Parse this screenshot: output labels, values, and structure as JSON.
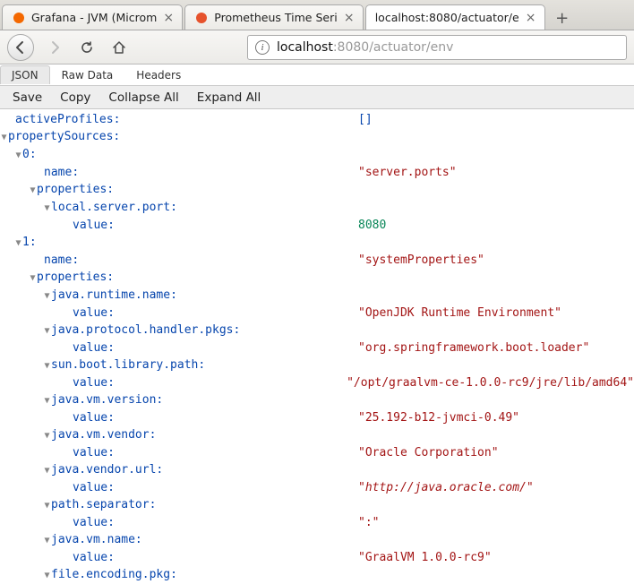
{
  "tabs": [
    {
      "title": "Grafana - JVM (Microm"
    },
    {
      "title": "Prometheus Time Seri"
    },
    {
      "title": "localhost:8080/actuator/e"
    }
  ],
  "url": {
    "host": "localhost",
    "portpath": ":8080/actuator/env"
  },
  "sub_tabs": {
    "json": "JSON",
    "raw": "Raw Data",
    "headers": "Headers"
  },
  "actions": {
    "save": "Save",
    "copy": "Copy",
    "collapse": "Collapse All",
    "expand": "Expand All"
  },
  "tree": {
    "activeProfiles_k": "activeProfiles",
    "activeProfiles_v": "[]",
    "propertySources_k": "propertySources",
    "ps0_idx": "0",
    "name_k": "name",
    "properties_k": "properties",
    "value_k": "value",
    "ps0_name_v": "\"server.ports\"",
    "ps0_prop0_k": "local.server.port",
    "ps0_prop0_v": "8080",
    "ps1_idx": "1",
    "ps1_name_v": "\"systemProperties\"",
    "ps1_p0_k": "java.runtime.name",
    "ps1_p0_v": "\"OpenJDK Runtime Environment\"",
    "ps1_p1_k": "java.protocol.handler.pkgs",
    "ps1_p1_v": "\"org.springframework.boot.loader\"",
    "ps1_p2_k": "sun.boot.library.path",
    "ps1_p2_v": "\"/opt/graalvm-ce-1.0.0-rc9/jre/lib/amd64\"",
    "ps1_p3_k": "java.vm.version",
    "ps1_p3_v": "\"25.192-b12-jvmci-0.49\"",
    "ps1_p4_k": "java.vm.vendor",
    "ps1_p4_v": "\"Oracle Corporation\"",
    "ps1_p5_k": "java.vendor.url",
    "ps1_p5_v_open": "\"",
    "ps1_p5_v_url": "http://java.oracle.com/",
    "ps1_p5_v_close": "\"",
    "ps1_p6_k": "path.separator",
    "ps1_p6_v": "\":\"",
    "ps1_p7_k": "java.vm.name",
    "ps1_p7_v": "\"GraalVM 1.0.0-rc9\"",
    "ps1_p8_k": "file.encoding.pkg"
  }
}
